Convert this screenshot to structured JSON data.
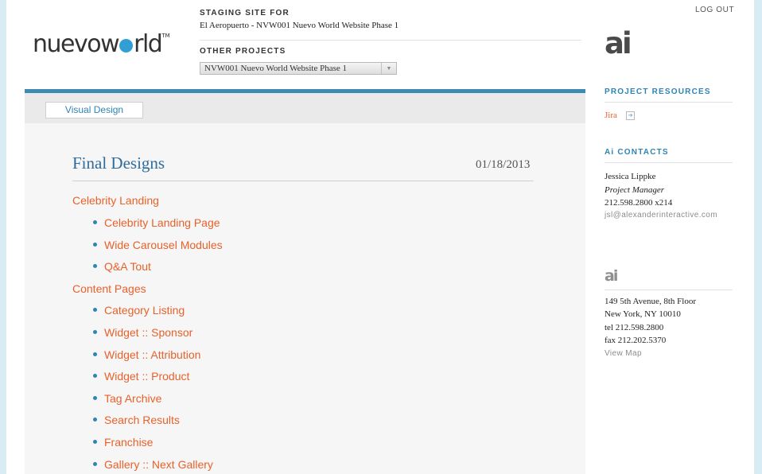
{
  "header": {
    "logo_text": "nuevoworld",
    "staging_label": "STAGING SITE FOR",
    "staging_title": "El Aeropuerto - NVW001 Nuevo World Website Phase 1",
    "other_projects_label": "OTHER PROJECTS",
    "project_select_value": "NVW001 Nuevo World Website Phase 1",
    "logout": "LOG OUT"
  },
  "tabs": [
    {
      "label": "Visual Design"
    }
  ],
  "main": {
    "heading": "Final Designs",
    "date": "01/18/2013",
    "groups": [
      {
        "title": "Celebrity Landing",
        "items": [
          "Celebrity Landing Page",
          "Wide Carousel Modules",
          "Q&A Tout"
        ]
      },
      {
        "title": "Content Pages",
        "items": [
          "Category Listing",
          "Widget :: Sponsor",
          "Widget :: Attribution",
          "Widget :: Product",
          "Tag Archive",
          "Search Results",
          "Franchise",
          "Gallery :: Next Gallery"
        ]
      }
    ]
  },
  "sidebar": {
    "brand_mark": "ai",
    "resources_label": "PROJECT RESOURCES",
    "resources": [
      {
        "label": "Jira"
      }
    ],
    "contacts_label": "Ai CONTACTS",
    "contact": {
      "name": "Jessica Lippke",
      "role": "Project Manager",
      "phone": "212.598.2800 x214",
      "email": "jsl@alexanderinteractive.com"
    },
    "office": {
      "mark": "ai",
      "address1": "149 5th Avenue, 8th Floor",
      "address2": "New York, NY 10010",
      "tel": "tel 212.598.2800",
      "fax": "fax 212.202.5370",
      "map_link": "View Map"
    }
  },
  "colors": {
    "accent_blue": "#2e84b3",
    "link_orange": "#e8612a",
    "bar_blue": "#3b8bb5"
  }
}
